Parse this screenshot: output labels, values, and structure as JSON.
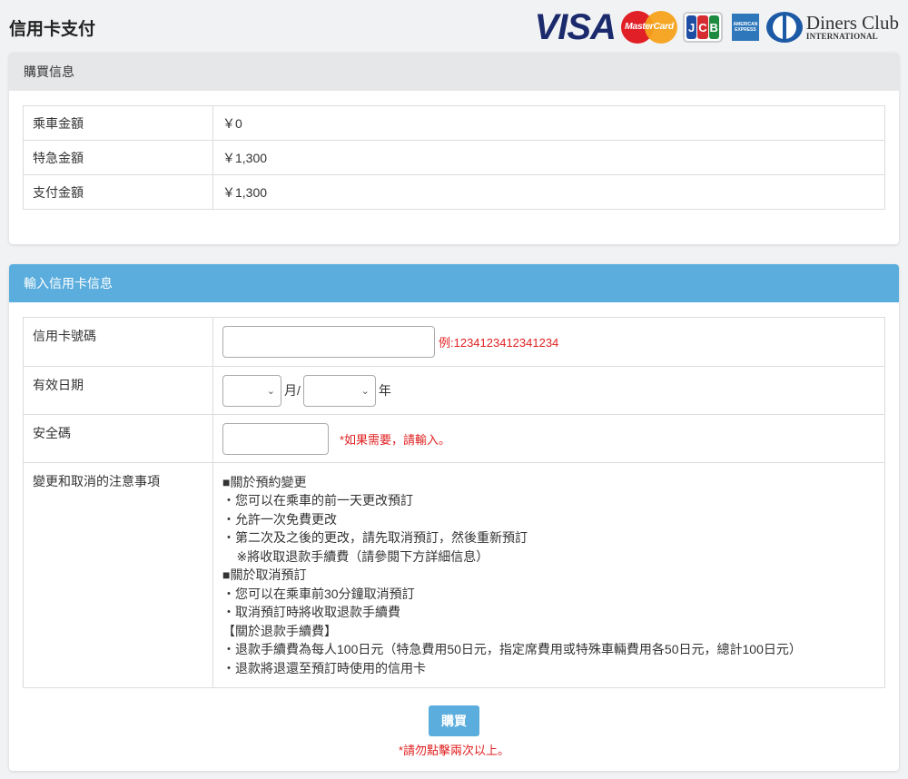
{
  "header": {
    "title": "信用卡支付",
    "logos": {
      "visa": "VISA",
      "mastercard": "MasterCard",
      "jcb": [
        "J",
        "C",
        "B"
      ],
      "amex": "AMERICAN EXPRESS",
      "diners_line1": "Diners Club",
      "diners_line2": "INTERNATIONAL"
    }
  },
  "purchase": {
    "title": "購買信息",
    "rows": [
      {
        "label": "乘車金額",
        "value": "￥0"
      },
      {
        "label": "特急金額",
        "value": "￥1,300"
      },
      {
        "label": "支付金額",
        "value": "￥1,300"
      }
    ]
  },
  "card": {
    "title": "輸入信用卡信息",
    "number_label": "信用卡號碼",
    "number_value": "",
    "number_hint": "例:1234123412341234",
    "expiry_label": "有效日期",
    "month_value": "",
    "month_unit": "月/",
    "year_value": "",
    "year_unit": "年",
    "cvc_label": "安全碼",
    "cvc_value": "",
    "cvc_hint": "*如果需要，請輸入。",
    "notes_label": "變更和取消的注意事項",
    "notes": [
      "■關於預約變更",
      "・您可以在乘車的前一天更改預訂",
      "・允許一次免費更改",
      "・第二次及之後的更改，請先取消預訂，然後重新預訂",
      "    ※將收取退款手續費（請參閱下方詳細信息）",
      "■關於取消預訂",
      "・您可以在乘車前30分鐘取消預訂",
      "・取消預訂時將收取退款手續費",
      "【關於退款手續費】",
      "・退款手續費為每人100日元（特急費用50日元，指定席費用或特殊車輛費用各50日元，總計100日元）",
      "・退款將退還至預訂時使用的信用卡"
    ],
    "buy_label": "購買",
    "warning": "*請勿點擊兩次以上。"
  }
}
